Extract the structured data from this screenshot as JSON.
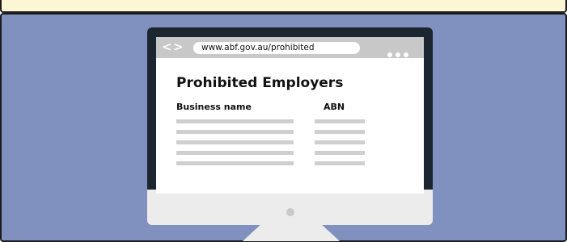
{
  "browser": {
    "url": "www.abf.gov.au/prohibited",
    "back_symbol": "<",
    "forward_symbol": ">",
    "menu_icon": "more-dots-icon"
  },
  "page": {
    "title": "Prohibited Employers",
    "columns": [
      "Business name",
      "ABN"
    ],
    "placeholder_rows": 5
  },
  "colors": {
    "background": "#8191bf",
    "top_band": "#fdf6d5",
    "monitor_frame": "#1b2630",
    "monitor_chin": "#ececec",
    "browser_bar": "#c8c8c8",
    "placeholder_line": "#cfcfcf"
  }
}
